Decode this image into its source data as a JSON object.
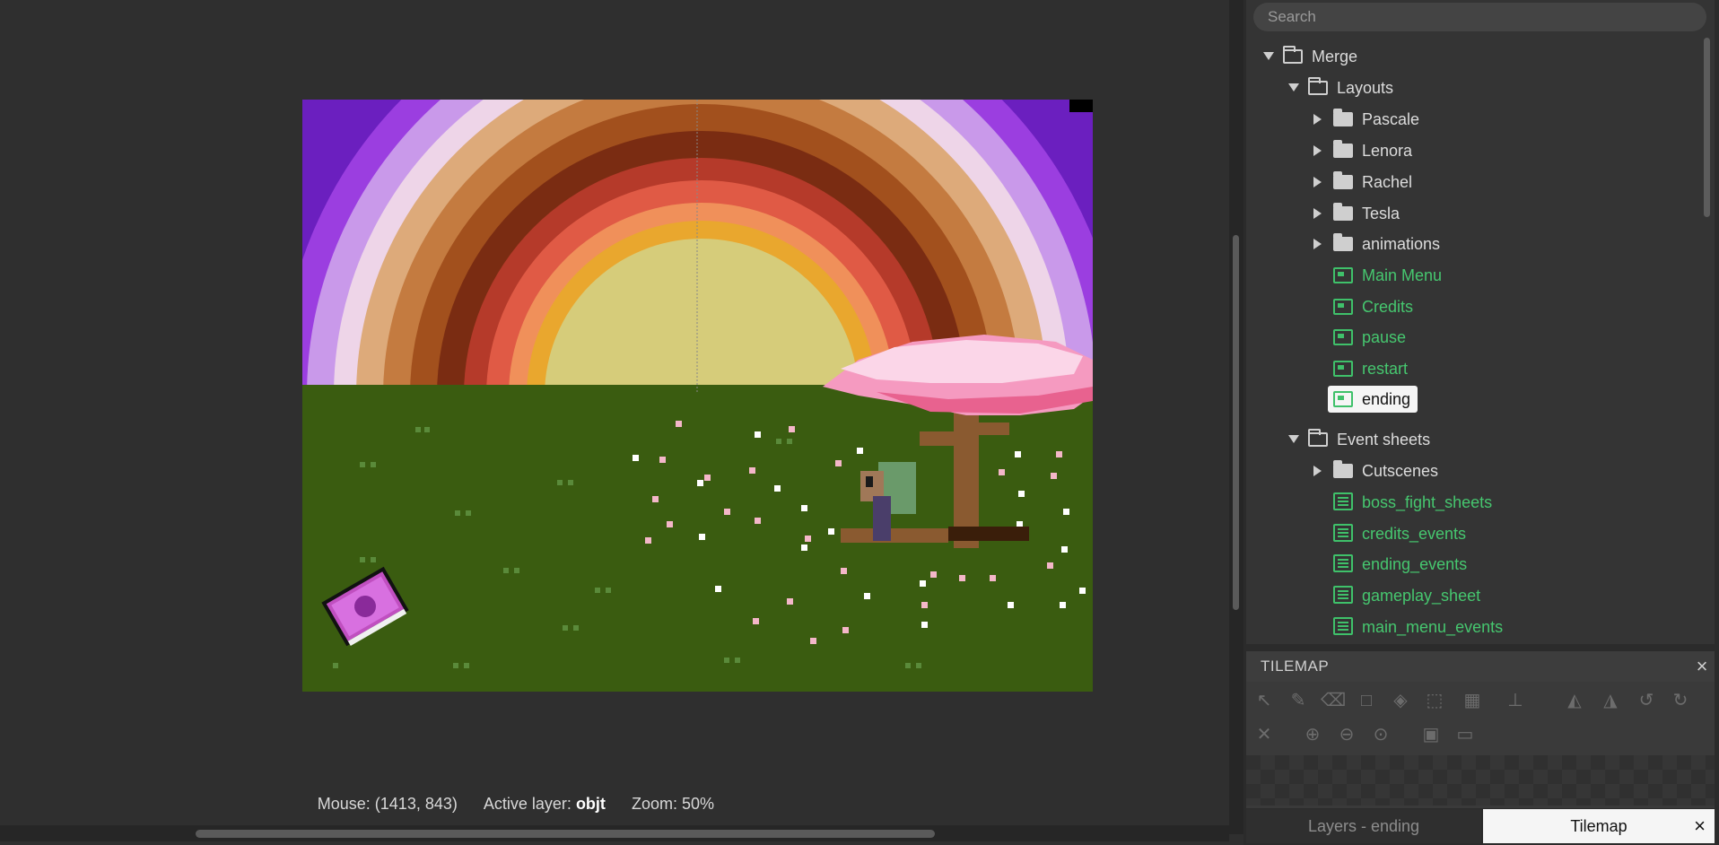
{
  "status": {
    "mouse": "Mouse: (1413, 843)",
    "active_layer_label": "Active layer:",
    "active_layer_value": "objt",
    "zoom": "Zoom: 50%"
  },
  "project": {
    "search_placeholder": "Search",
    "root": "Merge",
    "layouts_folder": "Layouts",
    "layout_subfolders": [
      "Pascale",
      "Lenora",
      "Rachel",
      "Tesla",
      "animations"
    ],
    "layouts": [
      "Main Menu",
      "Credits",
      "pause",
      "restart",
      "ending"
    ],
    "selected_layout": "ending",
    "event_sheets_folder": "Event sheets",
    "event_subfolders": [
      "Cutscenes"
    ],
    "event_sheets": [
      "boss_fight_sheets",
      "credits_events",
      "ending_events",
      "gameplay_sheet",
      "main_menu_events"
    ]
  },
  "tilemap": {
    "title": "TILEMAP",
    "tools_row1": [
      "select-icon",
      "pencil-icon",
      "eraser-icon",
      "rectangle-icon",
      "fill-icon",
      "marquee-icon",
      "tile-picker-icon",
      "stamp-icon",
      "flip-h-icon",
      "flip-v-icon",
      "rotate-ccw-icon",
      "rotate-cw-icon"
    ],
    "tools_row2": [
      "clear-icon",
      "zoom-in-icon",
      "zoom-out-icon",
      "zoom-reset-icon",
      "save-icon",
      "open-folder-icon"
    ]
  },
  "bottom_tabs": {
    "layers": "Layers - ending",
    "tilemap": "Tilemap"
  },
  "colors": {
    "accent_green": "#46c76f",
    "grass": "#3a5c10",
    "sun": "#d6cc7a",
    "blossom": "#f59ac0",
    "sky_purple": "#8a2bd0"
  }
}
